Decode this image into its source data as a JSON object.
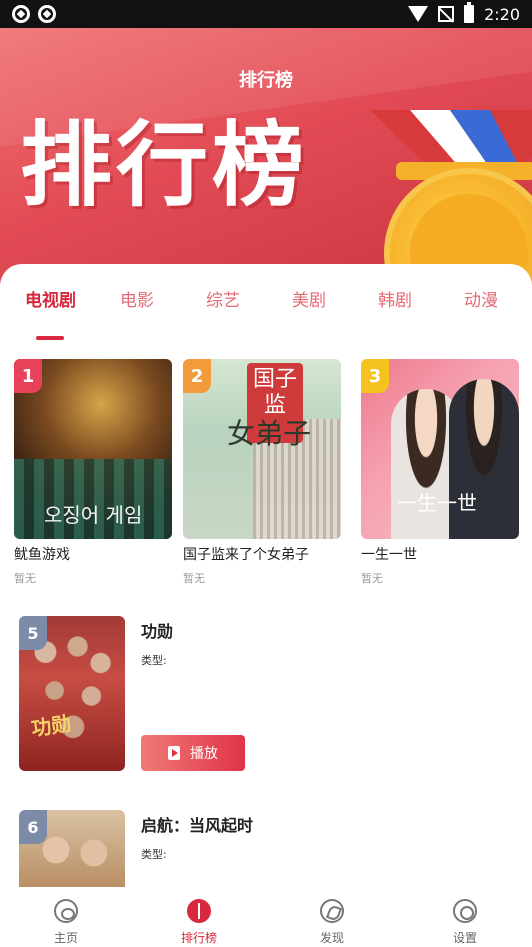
{
  "status_bar": {
    "time": "2:20"
  },
  "header": {
    "title": "排行榜",
    "banner_text": "排行榜"
  },
  "tabs": [
    {
      "label": "电视剧",
      "active": true
    },
    {
      "label": "电影"
    },
    {
      "label": "综艺"
    },
    {
      "label": "美剧"
    },
    {
      "label": "韩剧"
    },
    {
      "label": "动漫"
    }
  ],
  "top3": [
    {
      "rank": "1",
      "title": "鱿鱼游戏",
      "status": "暂无",
      "poster_text": "오징어 게임",
      "rank_color": "#e8415a"
    },
    {
      "rank": "2",
      "title": "国子监来了个女弟子",
      "status": "暂无",
      "poster_text_seal": "国子监",
      "poster_text_calli": "女弟子",
      "rank_color": "#f39a3a"
    },
    {
      "rank": "3",
      "title": "一生一世",
      "status": "暂无",
      "poster_text": "一生一世",
      "rank_color": "#f5c21f"
    }
  ],
  "list": [
    {
      "rank": "5",
      "title": "功勋",
      "type_label": "类型:",
      "play_label": "播放",
      "poster_text": "功勋"
    },
    {
      "rank": "6",
      "title": "启航：当风起时",
      "type_label": "类型:"
    }
  ],
  "bottom_nav": [
    {
      "label": "主页",
      "icon": "home-icon"
    },
    {
      "label": "排行榜",
      "icon": "ranking-icon",
      "active": true
    },
    {
      "label": "发现",
      "icon": "discover-icon"
    },
    {
      "label": "设置",
      "icon": "settings-icon"
    }
  ],
  "colors": {
    "accent": "#d8283d",
    "banner": "#e24b55",
    "medal": "#f7b52c"
  }
}
